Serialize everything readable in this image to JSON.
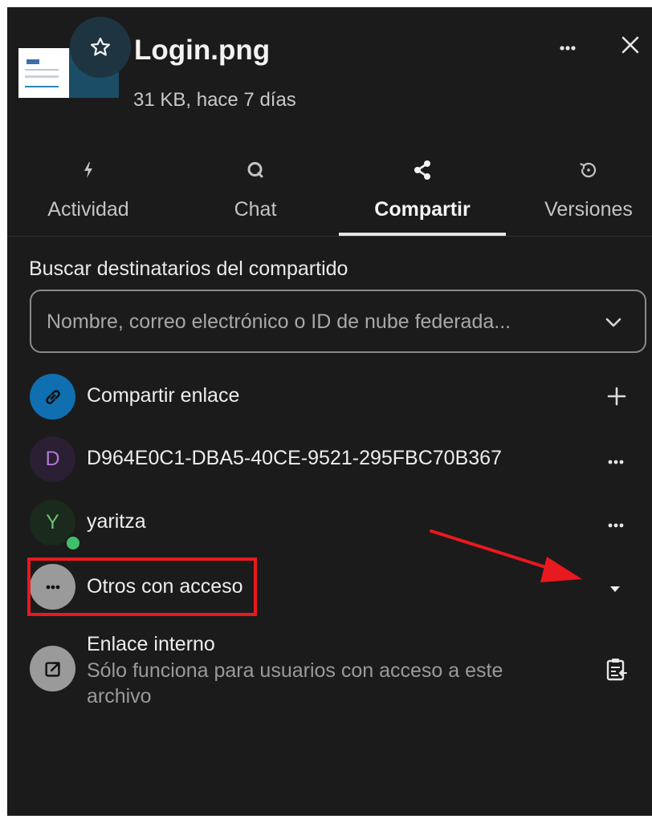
{
  "header": {
    "title": "Login.png",
    "meta": "31 KB, hace 7 días",
    "icons": {
      "favorite": "star-icon",
      "more": "more-horizontal-icon",
      "close": "close-icon"
    }
  },
  "tabs": [
    {
      "label": "Actividad",
      "icon": "lightning-icon",
      "active": false
    },
    {
      "label": "Chat",
      "icon": "chat-bubble-icon",
      "active": false
    },
    {
      "label": "Compartir",
      "icon": "share-icon",
      "active": true
    },
    {
      "label": "Versiones",
      "icon": "history-icon",
      "active": false
    }
  ],
  "search": {
    "label": "Buscar destinatarios del compartido",
    "placeholder": "Nombre, correo electrónico o ID de nube federada..."
  },
  "shares": {
    "link": {
      "label": "Compartir enlace",
      "action_icon": "plus-icon"
    },
    "users": [
      {
        "initial": "D",
        "label": "D964E0C1-DBA5-40CE-9521-295FBC70B367",
        "online": false
      },
      {
        "initial": "Y",
        "label": "yaritza",
        "online": true
      }
    ],
    "others": {
      "avatar_text": "•••",
      "label": "Otros con acceso",
      "action_icon": "caret-down-icon"
    },
    "internal_link": {
      "title": "Enlace interno",
      "description": "Sólo funciona para usuarios con acceso a este archivo",
      "action_icon": "clipboard-copy-icon"
    }
  },
  "annotations": {
    "highlight_color": "#e8191f",
    "arrow_color": "#e8191f"
  },
  "colors": {
    "background": "#1b1b1b",
    "link_avatar": "#0f6fb0",
    "online_status": "#3fbf69"
  }
}
